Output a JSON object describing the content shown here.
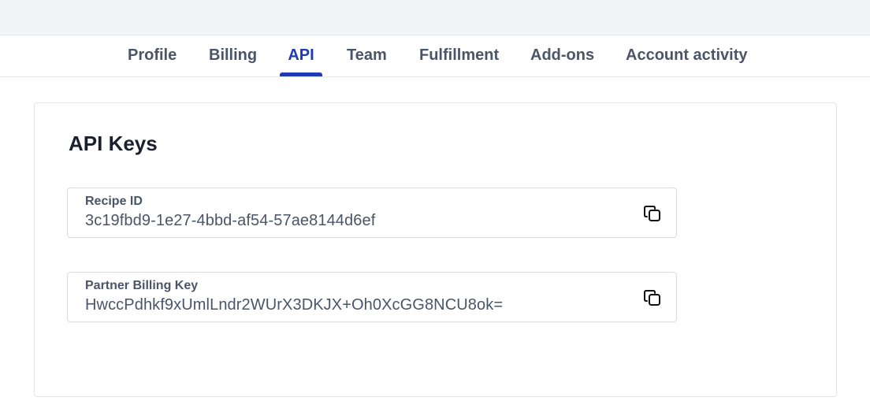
{
  "tabs": [
    {
      "label": "Profile"
    },
    {
      "label": "Billing"
    },
    {
      "label": "API"
    },
    {
      "label": "Team"
    },
    {
      "label": "Fulfillment"
    },
    {
      "label": "Add-ons"
    },
    {
      "label": "Account activity"
    }
  ],
  "active_tab": "API",
  "accent_color": "#1f3bb3",
  "card": {
    "title": "API Keys",
    "fields": [
      {
        "label": "Recipe ID",
        "value": "3c19fbd9-1e27-4bbd-af54-57ae8144d6ef",
        "action_icon": "copy-icon"
      },
      {
        "label": "Partner Billing Key",
        "value": "HwccPdhkf9xUmlLndr2WUrX3DKJX+Oh0XcGG8NCU8ok=",
        "action_icon": "copy-icon"
      }
    ]
  }
}
